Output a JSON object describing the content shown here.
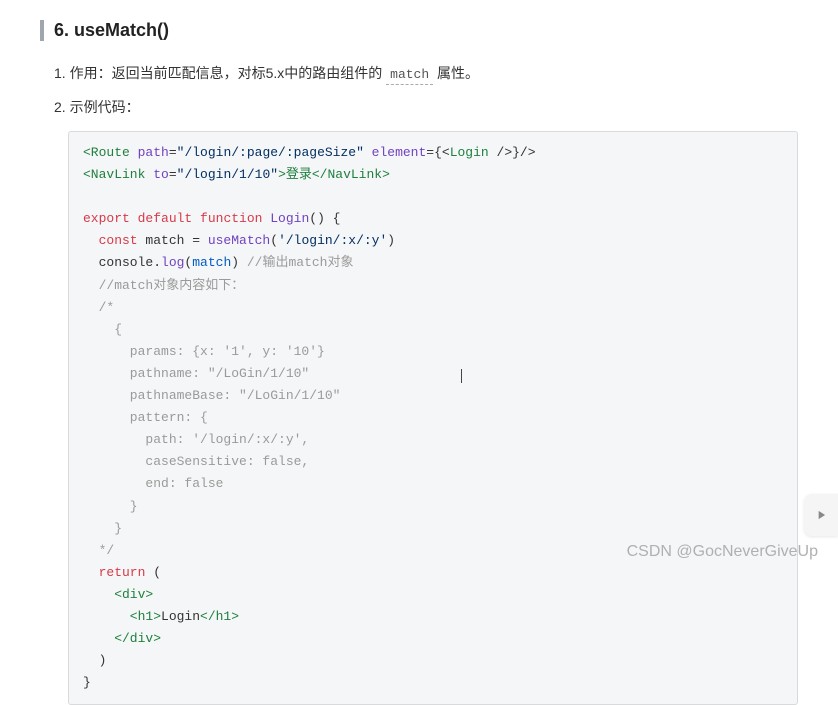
{
  "heading": "6. useMatch()",
  "item1_prefix": "1. 作用：返回当前匹配信息，对标5.x中的路由组件的 ",
  "item1_code": "match",
  "item1_suffix": " 属性。",
  "item2": "2. 示例代码：",
  "code": {
    "l1_a": "<Route ",
    "l1_b": "path",
    "l1_c": "=",
    "l1_d": "\"/login/:page/:pageSize\"",
    "l1_e": " element",
    "l1_f": "={<",
    "l1_g": "Login",
    "l1_h": " />}/>",
    "l2_a": "<NavLink ",
    "l2_b": "to",
    "l2_c": "=",
    "l2_d": "\"/login/1/10\"",
    "l2_e": ">登录</NavLink>",
    "l4_a": "export",
    "l4_b": " default",
    "l4_c": " function",
    "l4_d": " Login",
    "l4_e": "() {",
    "l5_a": "  const",
    "l5_b": " match = ",
    "l5_c": "useMatch",
    "l5_d": "(",
    "l5_e": "'/login/:x/:y'",
    "l5_f": ")",
    "l6_a": "  console.",
    "l6_b": "log",
    "l6_c": "(",
    "l6_d": "match",
    "l6_e": ") ",
    "l6_f": "//输出match对象",
    "l7": "  //match对象内容如下：",
    "l8": "  /*",
    "l9": "    {",
    "l10": "      params: {x: '1', y: '10'}",
    "l11": "      pathname: \"/LoGin/1/10\"",
    "l12": "      pathnameBase: \"/LoGin/1/10\"",
    "l13": "      pattern: {",
    "l14": "        path: '/login/:x/:y',",
    "l15": "        caseSensitive: false,",
    "l16": "        end: false",
    "l17": "      }",
    "l18": "    }",
    "l19": "  */",
    "l20_a": "  return",
    "l20_b": " (",
    "l21": "    <div>",
    "l22_a": "      <h1>",
    "l22_b": "Login",
    "l22_c": "</h1>",
    "l23": "    </div>",
    "l24": "  )",
    "l25": "}"
  },
  "watermark": "CSDN @GocNeverGiveUp"
}
